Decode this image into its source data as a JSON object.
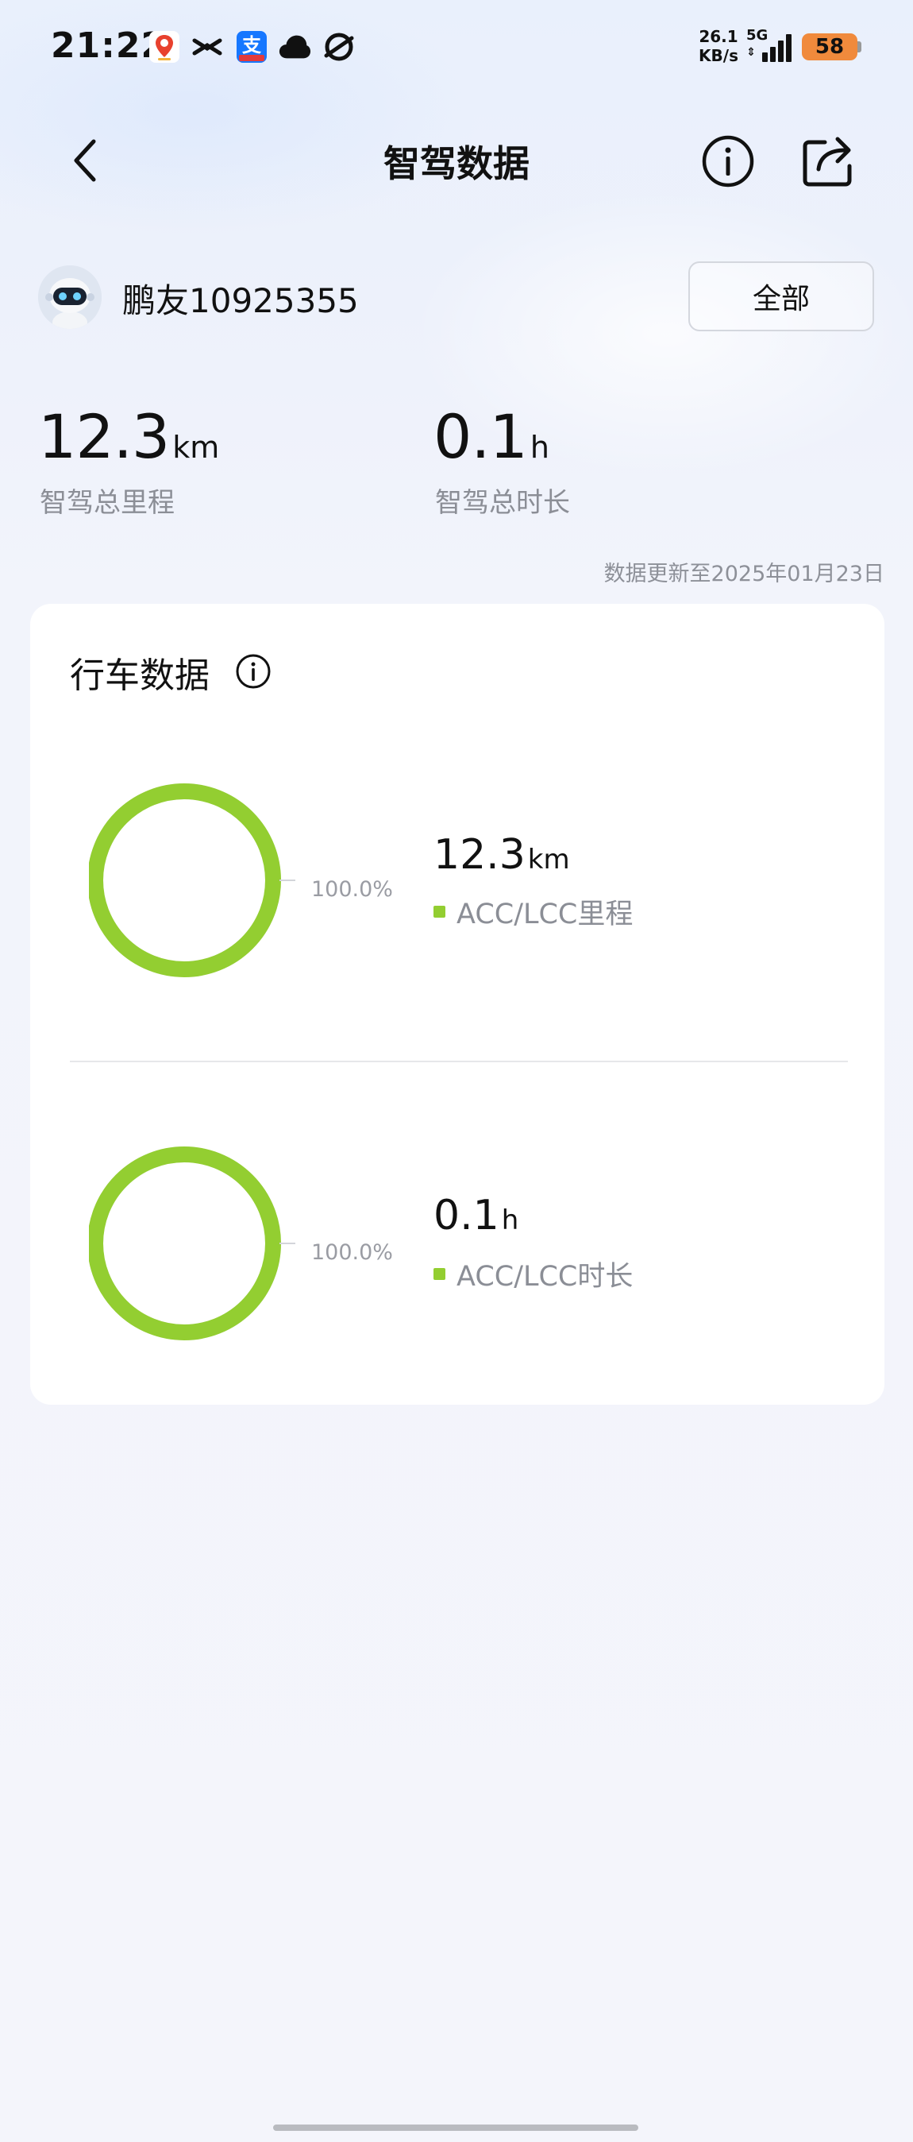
{
  "status_bar": {
    "time": "21:22",
    "net_speed_value": "26.1",
    "net_speed_unit": "KB/s",
    "network": "5G",
    "network_arrows": "⇕",
    "battery": "58",
    "alipay_badge": "支"
  },
  "header": {
    "title": "智驾数据"
  },
  "user": {
    "name": "鹏友10925355",
    "filter_label": "全部"
  },
  "summary": {
    "total_distance_value": "12.3",
    "total_distance_unit": "km",
    "total_distance_label": "智驾总里程",
    "total_duration_value": "0.1",
    "total_duration_unit": "h",
    "total_duration_label": "智驾总时长",
    "update_note": "数据更新至2025年01月23日"
  },
  "driving_card": {
    "title": "行车数据",
    "metrics": [
      {
        "percent": "100.0%",
        "value": "12.3",
        "unit": "km",
        "label": "ACC/LCC里程",
        "fraction": 1.0
      },
      {
        "percent": "100.0%",
        "value": "0.1",
        "unit": "h",
        "label": "ACC/LCC时长",
        "fraction": 1.0
      }
    ]
  },
  "colors": {
    "accent_green": "#93ce31",
    "battery_orange": "#f08a3c"
  },
  "icons": {
    "back": "chevron-left-icon",
    "info": "info-icon",
    "share": "share-icon"
  }
}
